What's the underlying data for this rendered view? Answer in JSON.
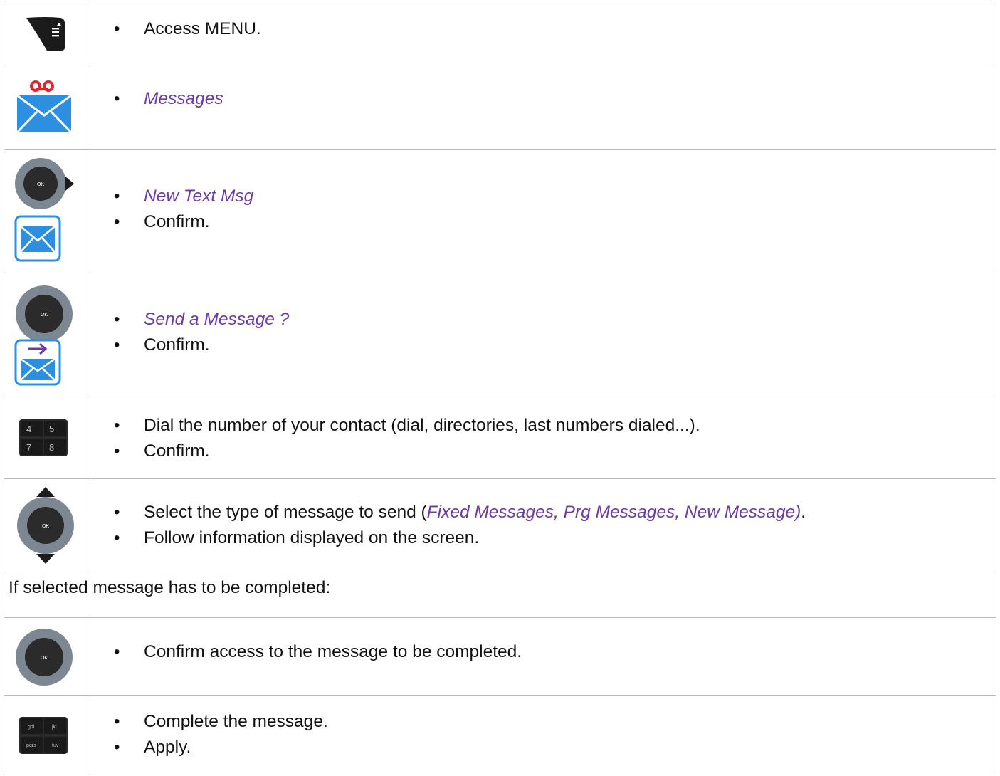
{
  "colors": {
    "menu_item": "#6b3aa8",
    "border": "#b8b8b8",
    "envelope_blue": "#2d8fe0",
    "voicemail_red": "#e0262a"
  },
  "rows": [
    {
      "icon": "menu-key-icon",
      "items": [
        {
          "text": "Access MENU."
        }
      ]
    },
    {
      "icon": "voicemail-envelope-icon",
      "items": [
        {
          "text": "Messages"
        }
      ]
    },
    {
      "icons": [
        "navigator-right-icon",
        "text-message-envelope-icon"
      ],
      "items": [
        {
          "text": "New Text Msg"
        },
        {
          "text": "Confirm."
        }
      ]
    },
    {
      "icons": [
        "ok-navigator-icon",
        "send-message-envelope-icon"
      ],
      "items": [
        {
          "text": "Send a Message ?"
        },
        {
          "text": "Confirm."
        }
      ]
    },
    {
      "icon": "numeric-keypad-icon",
      "keys": [
        "4",
        "5",
        "7",
        "8"
      ],
      "items": [
        {
          "text": "Dial the number of your contact (dial, directories, last numbers dialed...)."
        },
        {
          "text": "Confirm."
        }
      ]
    },
    {
      "icon": "navigator-up-down-icon",
      "items": [
        {
          "prefix": "Select the type of message to send (",
          "menu": "Fixed Messages, Prg Messages, New Message)",
          "suffix": "."
        },
        {
          "text": "Follow information displayed on the screen."
        }
      ]
    },
    {
      "full": "If selected message has to be completed:"
    },
    {
      "icon": "ok-navigator-icon",
      "items": [
        {
          "text": "Confirm access to the message to be completed."
        }
      ]
    },
    {
      "icon": "alpha-keypad-icon",
      "keys": [
        "ghi",
        "jkl",
        "pqrs",
        "tuv"
      ],
      "items": [
        {
          "text": "Complete the message."
        },
        {
          "text": "Apply."
        }
      ]
    }
  ],
  "ok_label": "OK"
}
